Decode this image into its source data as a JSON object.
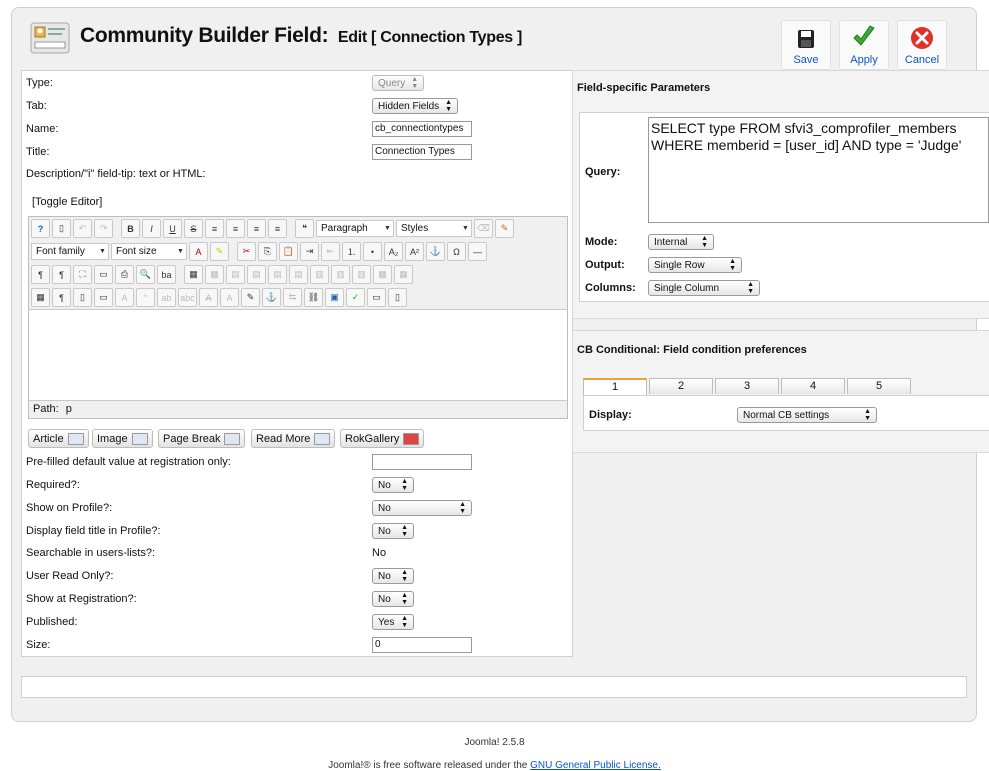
{
  "header": {
    "title": "Community Builder Field:",
    "subtitle": "Edit [ Connection Types ]"
  },
  "toolbar": {
    "save_label": "Save",
    "apply_label": "Apply",
    "cancel_label": "Cancel"
  },
  "form": {
    "type_label": "Type:",
    "type_value": "Query",
    "tab_label": "Tab:",
    "tab_value": "Hidden Fields",
    "name_label": "Name:",
    "name_value": "cb_connectiontypes",
    "title_label": "Title:",
    "title_value": "Connection Types",
    "description_label": "Description/\"i\" field-tip: text or HTML:",
    "toggle_editor": "[Toggle Editor]",
    "prefilled_label": "Pre-filled default value at registration only:",
    "prefilled_value": "",
    "required_label": "Required?:",
    "required_value": "No",
    "show_profile_label": "Show on Profile?:",
    "show_profile_value": "No",
    "display_title_label": "Display field title in Profile?:",
    "display_title_value": "No",
    "searchable_label": "Searchable in users-lists?:",
    "searchable_value": "No",
    "readonly_label": "User Read Only?:",
    "readonly_value": "No",
    "show_registration_label": "Show at Registration?:",
    "show_registration_value": "No",
    "published_label": "Published:",
    "published_value": "Yes",
    "size_label": "Size:",
    "size_value": "0"
  },
  "editor": {
    "format_value": "Paragraph",
    "styles_value": "Styles",
    "font_family_value": "Font family",
    "font_size_value": "Font size",
    "path_label": "Path:",
    "path_value": "p",
    "insert_buttons": [
      "Article",
      "Image",
      "Page Break",
      "Read More",
      "RokGallery"
    ],
    "icons": {
      "row1": [
        "help-icon",
        "new-document-icon",
        "undo-icon",
        "redo-icon",
        "bold-icon",
        "italic-icon",
        "underline-icon",
        "strikethrough-icon",
        "align-justify-icon",
        "align-center-icon",
        "align-left-icon",
        "align-right-icon",
        "blockquote-icon",
        "format-select",
        "styles-select",
        "eraser-icon",
        "cleanup-icon"
      ],
      "row2": [
        "font-family-select",
        "font-size-select",
        "text-color-icon",
        "highlight-color-icon",
        "cut-icon",
        "copy-icon",
        "paste-icon",
        "indent-icon",
        "outdent-icon",
        "numbered-list-icon",
        "bullet-list-icon",
        "subscript-icon",
        "superscript-icon",
        "charmap-icon",
        "horizontal-rule-icon"
      ],
      "row3": [
        "ltr-icon",
        "rtl-icon",
        "fullscreen-icon",
        "preview-icon",
        "print-icon",
        "find-icon",
        "replace-icon",
        "table-icon",
        "delete-table-icon",
        "row-props-icon",
        "insert-row-before-icon",
        "insert-row-after-icon",
        "delete-row-icon",
        "col-before-icon",
        "col-after-icon",
        "delete-col-icon",
        "merge-cells-icon",
        "split-cells-icon"
      ],
      "row4": [
        "visual-aid-icon",
        "show-blocks-icon",
        "template-icon",
        "non-break-icon",
        "styleprops-icon",
        "abbr-icon",
        "cite-icon",
        "acronym-icon",
        "del-icon",
        "ins-icon",
        "attribs-icon",
        "insert-layer-icon",
        "absolute-icon",
        "move-backward-icon",
        "link-icon",
        "image-icon",
        "spellcheck-icon",
        "media-icon",
        "pagebreak-icon"
      ]
    }
  },
  "field_params": {
    "title": "Field-specific Parameters",
    "query_label": "Query:",
    "query_value": "SELECT type FROM sfvi3_comprofiler_members\nWHERE memberid = [user_id] AND type = 'Judge'",
    "mode_label": "Mode:",
    "mode_value": "Internal",
    "output_label": "Output:",
    "output_value": "Single Row",
    "columns_label": "Columns:",
    "columns_value": "Single Column"
  },
  "conditional": {
    "title": "CB Conditional: Field condition preferences",
    "tabs": [
      "1",
      "2",
      "3",
      "4",
      "5"
    ],
    "display_label": "Display:",
    "display_value": "Normal CB settings"
  },
  "footer": {
    "version": "Joomla! 2.5.8",
    "license_prefix": "Joomla!® is free software released under the ",
    "license_link": "GNU General Public License."
  },
  "colors": {
    "accent": "#0b55c4",
    "apply_green": "#3aaa35",
    "cancel_red": "#e0302a",
    "active_tab": "#f0a030"
  }
}
